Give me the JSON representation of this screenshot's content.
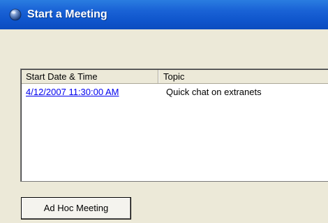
{
  "window": {
    "title": "Start a Meeting",
    "icon": "globe-icon"
  },
  "meetings": {
    "columns": [
      "Start Date & Time",
      "Topic"
    ],
    "rows": [
      {
        "start": "4/12/2007 11:30:00 AM",
        "topic": "Quick chat on extranets"
      }
    ]
  },
  "actions": {
    "adhoc_label": "Ad Hoc Meeting"
  },
  "colors": {
    "titlebar": "#0f55cc",
    "link": "#0000ee",
    "window_background": "#ece9d8"
  }
}
